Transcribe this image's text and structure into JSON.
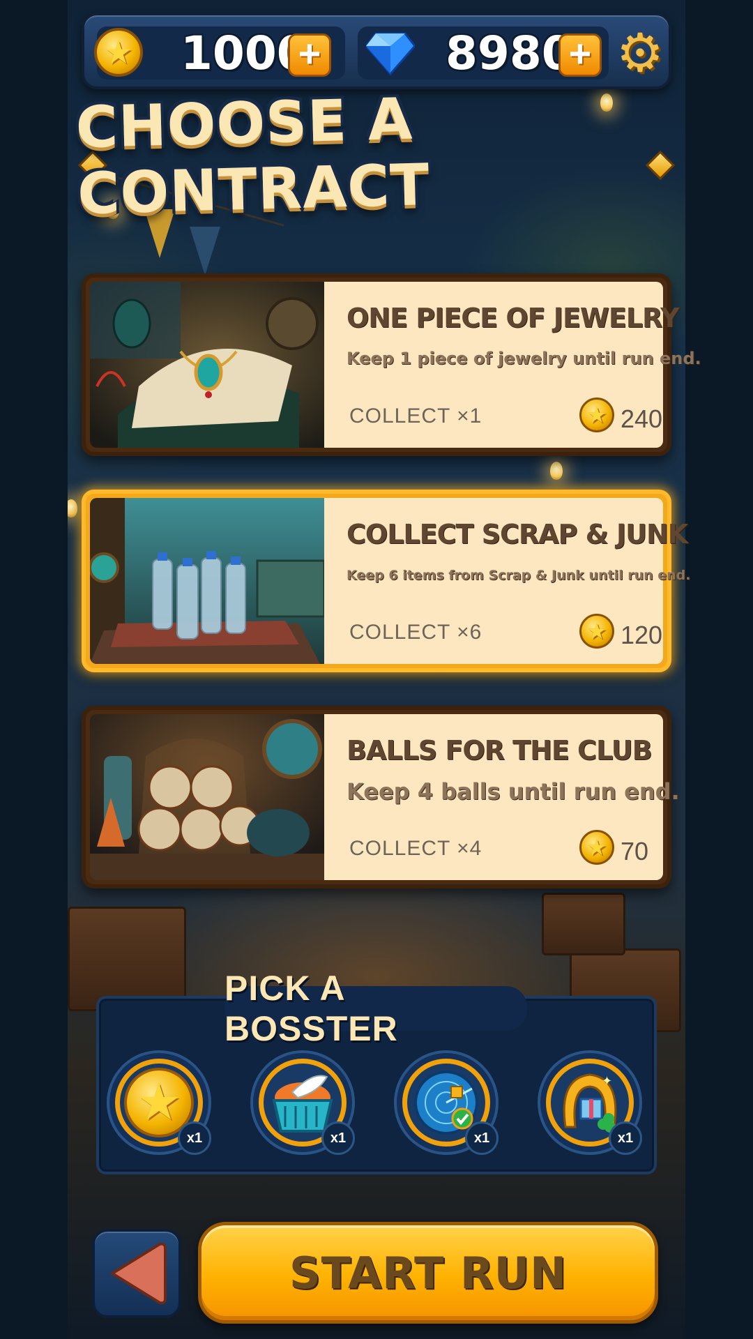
{
  "header": {
    "coins": "1000",
    "gems": "8980",
    "icons": [
      "coin-icon",
      "plus-icon",
      "gem-icon",
      "plus-icon",
      "gear-icon"
    ]
  },
  "title": "CHOOSE A CONTRACT",
  "contracts": [
    {
      "title": "ONE PIECE OF JEWELRY",
      "description": "Keep 1 piece of jewelry until run end.",
      "collect": "COLLECT ×1",
      "reward": "240",
      "selected": false
    },
    {
      "title": "COLLECT SCRAP & JUNK",
      "description": "Keep 6 items from Scrap & Junk until run end.",
      "collect": "COLLECT ×6",
      "reward": "120",
      "selected": true
    },
    {
      "title": "BALLS FOR THE CLUB",
      "description": "Keep 4 balls until run end.",
      "collect": "COLLECT ×4",
      "reward": "70",
      "selected": false
    }
  ],
  "booster": {
    "title": "PICK A BOSSTER",
    "items": [
      {
        "icon": "coin-star-icon",
        "count": "x1"
      },
      {
        "icon": "basket-feather-icon",
        "count": "x1"
      },
      {
        "icon": "radar-icon",
        "count": "x1"
      },
      {
        "icon": "lucky-horseshoe-icon",
        "count": "x1"
      }
    ]
  },
  "actions": {
    "start": "START RUN"
  },
  "colors": {
    "accent": "#ffb200",
    "card_bg": "#fde7c0",
    "selected_border": "#ffb92a",
    "panel": "#0e2440"
  }
}
